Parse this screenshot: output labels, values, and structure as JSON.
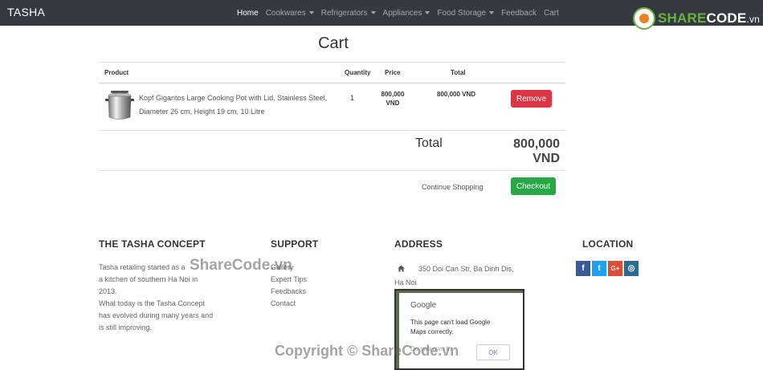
{
  "navbar": {
    "brand": "TASHA",
    "items": [
      {
        "label": "Home",
        "active": true,
        "dropdown": false
      },
      {
        "label": "Cookwares",
        "active": false,
        "dropdown": true
      },
      {
        "label": "Refrigerators",
        "active": false,
        "dropdown": true
      },
      {
        "label": "Appliances",
        "active": false,
        "dropdown": true
      },
      {
        "label": "Food Storage",
        "active": false,
        "dropdown": true
      },
      {
        "label": "Feedback",
        "active": false,
        "dropdown": false
      },
      {
        "label": "Cart",
        "active": false,
        "dropdown": false
      }
    ],
    "background": "#343a40"
  },
  "logo": {
    "part_a": "SHARE",
    "part_b": "CODE",
    "part_c": ".vn"
  },
  "cart": {
    "title": "Cart",
    "headers": {
      "product": "Product",
      "quantity": "Quantity",
      "price": "Price",
      "total": "Total"
    },
    "items": [
      {
        "name": "Kopf Gigantos Large Cooking Pot with Lid, Stainless Steel, Diameter 26 cm, Height 19 cm, 10 Litre",
        "quantity": "1",
        "price": "800,000 VND",
        "total": "800,000 VND",
        "remove_label": "Remove",
        "image_icon": "cooking-pot"
      }
    ],
    "total_label": "Total",
    "total_value": "800,000 VND",
    "continue_label": "Continue Shopping",
    "checkout_label": "Checkout",
    "remove_color": "#dc3545",
    "checkout_color": "#28a745"
  },
  "footer": {
    "concept": {
      "heading": "THE TASHA CONCEPT",
      "line1": "Tasha retailing started as a",
      "line2": "a kitchen of southern Ha Noi in",
      "line3": "2013.",
      "line4": "What today is the Tasha Concept",
      "line5": "has evolved during many years and",
      "line6": "is still improving."
    },
    "support": {
      "heading": "SUPPORT",
      "links": [
        "Gallery",
        "Expert Tips",
        "Feedbacks",
        "Contact"
      ]
    },
    "address": {
      "heading": "ADDRESS",
      "line1": "350 Doi Can Str, Ba Dinh Dis,",
      "line2": "Ha Noi",
      "map_dialog": {
        "brand": "Google",
        "message": "This page can't load Google Maps correctly.",
        "owner_text": "Do you own th",
        "ok_label": "OK"
      }
    },
    "location": {
      "heading": "LOCATION",
      "social": [
        {
          "icon": "facebook-icon",
          "glyph": "f",
          "color": "#3b5998"
        },
        {
          "icon": "twitter-icon",
          "glyph": "t",
          "color": "#1da1f2"
        },
        {
          "icon": "google-plus-icon",
          "glyph": "G+",
          "color": "#dd4b39"
        },
        {
          "icon": "instagram-icon",
          "glyph": "◎",
          "color": "#2b6b8f"
        }
      ]
    }
  },
  "watermarks": {
    "center": "ShareCode.vn",
    "bottom": "Copyright © ShareCode.vn"
  }
}
